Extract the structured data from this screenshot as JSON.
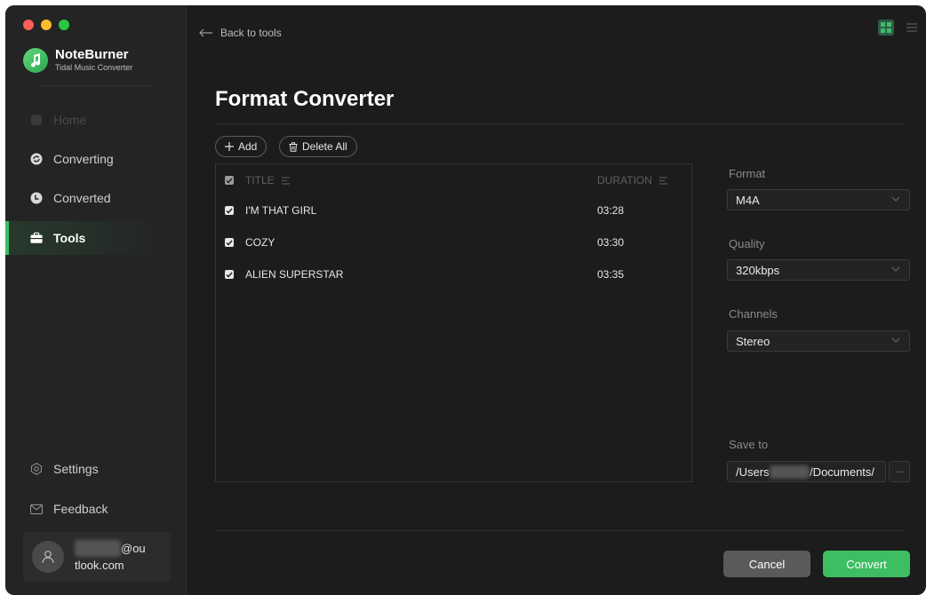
{
  "app": {
    "brand_name": "NoteBurner",
    "brand_subtitle": "Tidal Music Converter"
  },
  "sidebar": {
    "items": [
      {
        "label": "Home",
        "icon": "home-icon",
        "state": "disabled"
      },
      {
        "label": "Converting",
        "icon": "sync-icon",
        "state": "normal"
      },
      {
        "label": "Converted",
        "icon": "clock-icon",
        "state": "normal"
      },
      {
        "label": "Tools",
        "icon": "toolbox-icon",
        "state": "active"
      }
    ],
    "settings_label": "Settings",
    "feedback_label": "Feedback",
    "user": {
      "email_hidden": "xxxxxxxx",
      "email_line1": "@ou",
      "email_line2": "tlook.com"
    }
  },
  "header": {
    "back_label": "Back to tools"
  },
  "main": {
    "title": "Format Converter",
    "add_label": "Add",
    "delete_all_label": "Delete All",
    "table": {
      "col_title": "TITLE",
      "col_duration": "DURATION",
      "rows": [
        {
          "title": "I'M THAT GIRL",
          "duration": "03:28",
          "checked": true
        },
        {
          "title": "COZY",
          "duration": "03:30",
          "checked": true
        },
        {
          "title": "ALIEN SUPERSTAR",
          "duration": "03:35",
          "checked": true
        }
      ]
    }
  },
  "options": {
    "format_label": "Format",
    "format_value": "M4A",
    "quality_label": "Quality",
    "quality_value": "320kbps",
    "channels_label": "Channels",
    "channels_value": "Stereo",
    "save_to_label": "Save to",
    "save_path_prefix": "/Users",
    "save_path_hidden": "xxxxxxx",
    "save_path_suffix": "/Documents/",
    "browse_label": "···"
  },
  "actions": {
    "cancel_label": "Cancel",
    "convert_label": "Convert"
  },
  "colors": {
    "accent": "#3dbe62",
    "window_bg": "#1c1c1c",
    "sidebar_bg": "#242424"
  }
}
